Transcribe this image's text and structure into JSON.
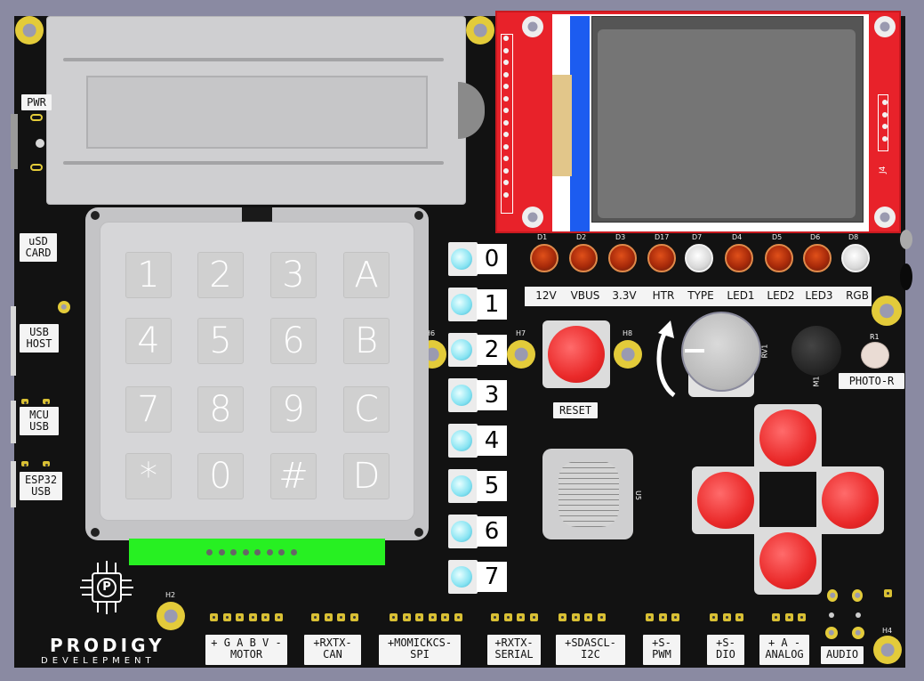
{
  "brand": {
    "name": "PRODIGY",
    "sub": "DEVELEPMENT",
    "logo_letter": "P"
  },
  "side_labels": [
    "PWR",
    "uSD\nCARD",
    "USB\nHOST",
    "MCU\nUSB",
    "ESP32\nUSB"
  ],
  "keypad": {
    "keys": [
      "1",
      "2",
      "3",
      "A",
      "4",
      "5",
      "6",
      "B",
      "7",
      "8",
      "9",
      "C",
      "*",
      "0",
      "#",
      "D"
    ]
  },
  "led_buttons": [
    "0",
    "1",
    "2",
    "3",
    "4",
    "5",
    "6",
    "7"
  ],
  "indicator_leds": {
    "refs": [
      "D1",
      "D2",
      "D3",
      "D17",
      "D7",
      "D4",
      "D5",
      "D6",
      "D8"
    ],
    "labels": [
      "12V",
      "VBUS",
      "3.3V",
      "HTR",
      "TYPE",
      "LED1",
      "LED2",
      "LED3",
      "RGB"
    ],
    "colors": [
      "red",
      "red",
      "red",
      "red",
      "white",
      "red",
      "red",
      "red",
      "white"
    ]
  },
  "hole_labels": [
    "H7",
    "H8",
    "H2",
    "H4",
    "H6"
  ],
  "reset_label": "RESET",
  "pot_ref": "RV1",
  "buzzer_ref": "M1",
  "photo": {
    "ref": "R1",
    "label": "PHOTO-R"
  },
  "joystick_ref": "U5",
  "tft_ref": "J4",
  "headers": [
    {
      "pins": "+ G A B V -",
      "name": "MOTOR"
    },
    {
      "pins": "+RXTX-",
      "name": "CAN"
    },
    {
      "pins": "+MOMICKCS-",
      "name": "SPI"
    },
    {
      "pins": "+RXTX-",
      "name": "SERIAL"
    },
    {
      "pins": "+SDASCL-",
      "name": "I2C"
    },
    {
      "pins": "+S-",
      "name": "PWM"
    },
    {
      "pins": "+S-",
      "name": "DIO"
    },
    {
      "pins": "+ A -",
      "name": "ANALOG"
    },
    {
      "pins": "",
      "name": "AUDIO"
    }
  ],
  "colors": {
    "board": "#121212",
    "red_button": "#ea2a2a",
    "tft_pcb": "#e8222a",
    "green_strip": "#27f022",
    "pad_gold": "#e3cb3a"
  }
}
